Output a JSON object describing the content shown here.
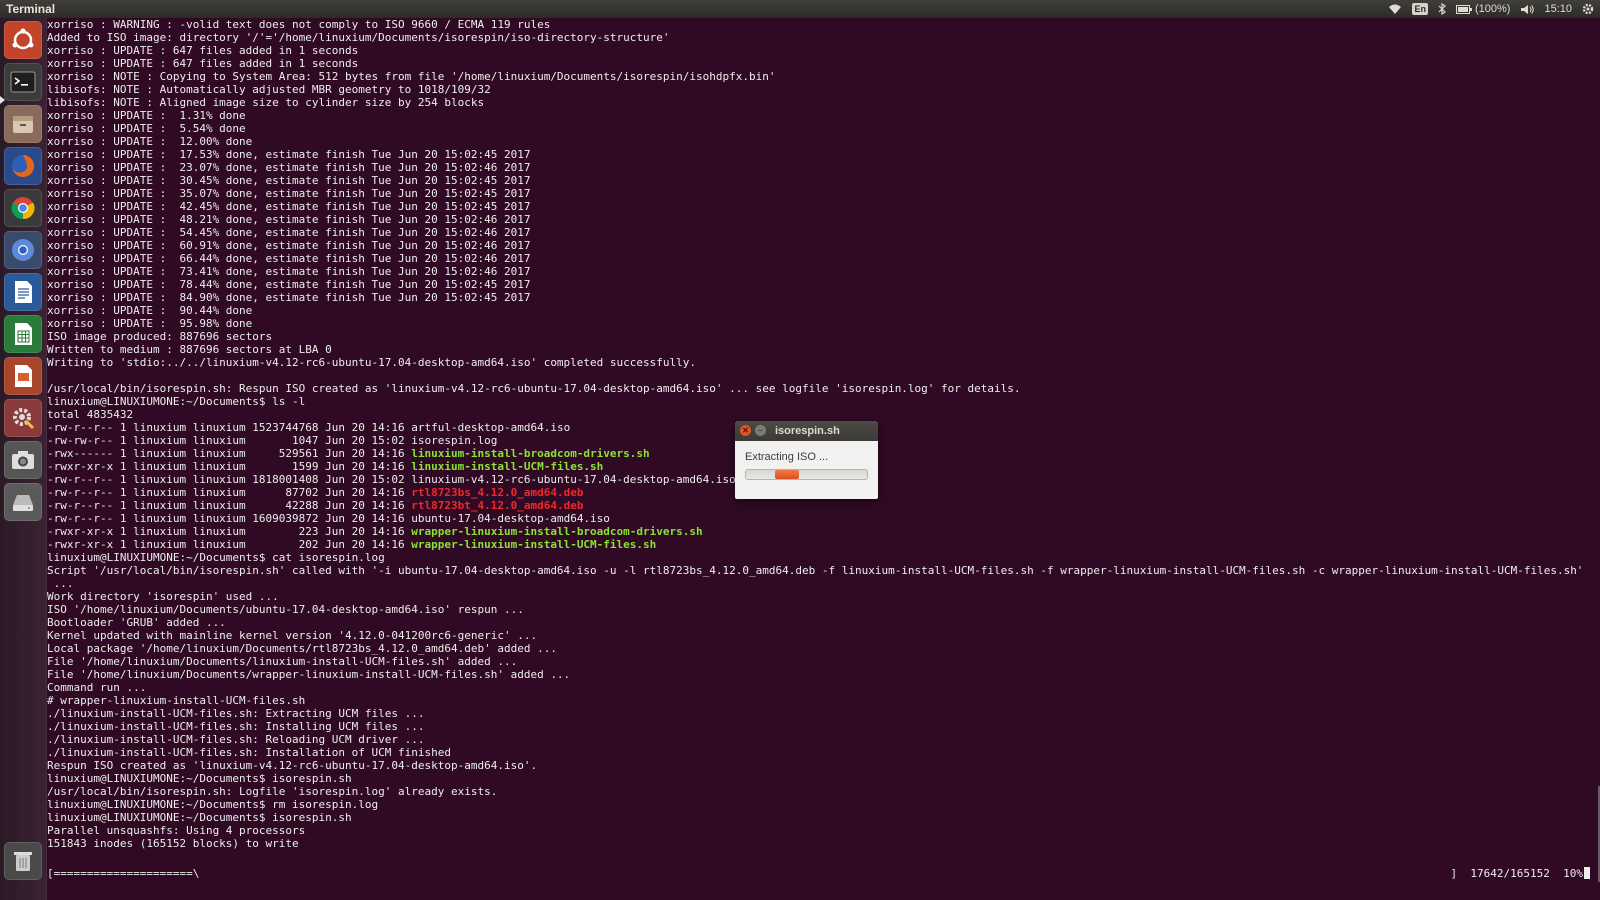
{
  "window": {
    "title": "Terminal"
  },
  "tray": {
    "lang": "En",
    "battery": "(100%)",
    "time": "15:10"
  },
  "launcher": {
    "items": [
      {
        "name": "dash-home"
      },
      {
        "name": "terminal-app"
      },
      {
        "name": "files-app"
      },
      {
        "name": "firefox-app"
      },
      {
        "name": "chrome-app"
      },
      {
        "name": "chromium-app"
      },
      {
        "name": "libreoffice-writer-app"
      },
      {
        "name": "libreoffice-calc-app"
      },
      {
        "name": "libreoffice-impress-app"
      },
      {
        "name": "system-settings-app"
      },
      {
        "name": "screenshot-app"
      },
      {
        "name": "drive-app"
      },
      {
        "name": "trash"
      }
    ]
  },
  "colors": {
    "terminal_bg": "#300a24",
    "exec_green": "#8ae234",
    "pkg_red": "#ef2929"
  },
  "terminal": {
    "lines": [
      {
        "text": "xorriso : WARNING : -volid text does not comply to ISO 9660 / ECMA 119 rules"
      },
      {
        "text": "Added to ISO image: directory '/'='/home/linuxium/Documents/isorespin/iso-directory-structure'"
      },
      {
        "text": "xorriso : UPDATE : 647 files added in 1 seconds"
      },
      {
        "text": "xorriso : UPDATE : 647 files added in 1 seconds"
      },
      {
        "text": "xorriso : NOTE : Copying to System Area: 512 bytes from file '/home/linuxium/Documents/isorespin/isohdpfx.bin'"
      },
      {
        "text": "libisofs: NOTE : Automatically adjusted MBR geometry to 1018/109/32"
      },
      {
        "text": "libisofs: NOTE : Aligned image size to cylinder size by 254 blocks"
      },
      {
        "text": "xorriso : UPDATE :  1.31% done"
      },
      {
        "text": "xorriso : UPDATE :  5.54% done"
      },
      {
        "text": "xorriso : UPDATE :  12.00% done"
      },
      {
        "text": "xorriso : UPDATE :  17.53% done, estimate finish Tue Jun 20 15:02:45 2017"
      },
      {
        "text": "xorriso : UPDATE :  23.07% done, estimate finish Tue Jun 20 15:02:46 2017"
      },
      {
        "text": "xorriso : UPDATE :  30.45% done, estimate finish Tue Jun 20 15:02:45 2017"
      },
      {
        "text": "xorriso : UPDATE :  35.07% done, estimate finish Tue Jun 20 15:02:45 2017"
      },
      {
        "text": "xorriso : UPDATE :  42.45% done, estimate finish Tue Jun 20 15:02:45 2017"
      },
      {
        "text": "xorriso : UPDATE :  48.21% done, estimate finish Tue Jun 20 15:02:46 2017"
      },
      {
        "text": "xorriso : UPDATE :  54.45% done, estimate finish Tue Jun 20 15:02:46 2017"
      },
      {
        "text": "xorriso : UPDATE :  60.91% done, estimate finish Tue Jun 20 15:02:46 2017"
      },
      {
        "text": "xorriso : UPDATE :  66.44% done, estimate finish Tue Jun 20 15:02:46 2017"
      },
      {
        "text": "xorriso : UPDATE :  73.41% done, estimate finish Tue Jun 20 15:02:46 2017"
      },
      {
        "text": "xorriso : UPDATE :  78.44% done, estimate finish Tue Jun 20 15:02:45 2017"
      },
      {
        "text": "xorriso : UPDATE :  84.90% done, estimate finish Tue Jun 20 15:02:45 2017"
      },
      {
        "text": "xorriso : UPDATE :  90.44% done"
      },
      {
        "text": "xorriso : UPDATE :  95.98% done"
      },
      {
        "text": "ISO image produced: 887696 sectors"
      },
      {
        "text": "Written to medium : 887696 sectors at LBA 0"
      },
      {
        "text": "Writing to 'stdio:../../linuxium-v4.12-rc6-ubuntu-17.04-desktop-amd64.iso' completed successfully."
      },
      {
        "text": ""
      },
      {
        "text": "/usr/local/bin/isorespin.sh: Respun ISO created as 'linuxium-v4.12-rc6-ubuntu-17.04-desktop-amd64.iso' ... see logfile 'isorespin.log' for details."
      },
      {
        "text": "linuxium@LINUXIUMONE:~/Documents$ ls -l"
      },
      {
        "text": "total 4835432"
      },
      {
        "text": "-rw-r--r-- 1 linuxium linuxium 1523744768 Jun 20 14:16 ",
        "file": "artful-desktop-amd64.iso",
        "cls": ""
      },
      {
        "text": "-rw-rw-r-- 1 linuxium linuxium       1047 Jun 20 15:02 ",
        "file": "isorespin.log",
        "cls": ""
      },
      {
        "text": "-rwx------ 1 linuxium linuxium     529561 Jun 20 14:16 ",
        "file": "linuxium-install-broadcom-drivers.sh",
        "cls": "green"
      },
      {
        "text": "-rwxr-xr-x 1 linuxium linuxium       1599 Jun 20 14:16 ",
        "file": "linuxium-install-UCM-files.sh",
        "cls": "green"
      },
      {
        "text": "-rw-r--r-- 1 linuxium linuxium 1818001408 Jun 20 15:02 ",
        "file": "linuxium-v4.12-rc6-ubuntu-17.04-desktop-amd64.iso",
        "cls": ""
      },
      {
        "text": "-rw-r--r-- 1 linuxium linuxium      87702 Jun 20 14:16 ",
        "file": "rtl8723bs_4.12.0_amd64.deb",
        "cls": "red"
      },
      {
        "text": "-rw-r--r-- 1 linuxium linuxium      42288 Jun 20 14:16 ",
        "file": "rtl8723bt_4.12.0_amd64.deb",
        "cls": "red"
      },
      {
        "text": "-rw-r--r-- 1 linuxium linuxium 1609039872 Jun 20 14:16 ",
        "file": "ubuntu-17.04-desktop-amd64.iso",
        "cls": ""
      },
      {
        "text": "-rwxr-xr-x 1 linuxium linuxium        223 Jun 20 14:16 ",
        "file": "wrapper-linuxium-install-broadcom-drivers.sh",
        "cls": "green"
      },
      {
        "text": "-rwxr-xr-x 1 linuxium linuxium        202 Jun 20 14:16 ",
        "file": "wrapper-linuxium-install-UCM-files.sh",
        "cls": "green"
      },
      {
        "text": "linuxium@LINUXIUMONE:~/Documents$ cat isorespin.log"
      },
      {
        "text": "Script '/usr/local/bin/isorespin.sh' called with '-i ubuntu-17.04-desktop-amd64.iso -u -l rtl8723bs_4.12.0_amd64.deb -f linuxium-install-UCM-files.sh -f wrapper-linuxium-install-UCM-files.sh -c wrapper-linuxium-install-UCM-files.sh'"
      },
      {
        "text": " ..."
      },
      {
        "text": "Work directory 'isorespin' used ..."
      },
      {
        "text": "ISO '/home/linuxium/Documents/ubuntu-17.04-desktop-amd64.iso' respun ..."
      },
      {
        "text": "Bootloader 'GRUB' added ..."
      },
      {
        "text": "Kernel updated with mainline kernel version '4.12.0-041200rc6-generic' ..."
      },
      {
        "text": "Local package '/home/linuxium/Documents/rtl8723bs_4.12.0_amd64.deb' added ..."
      },
      {
        "text": "File '/home/linuxium/Documents/linuxium-install-UCM-files.sh' added ..."
      },
      {
        "text": "File '/home/linuxium/Documents/wrapper-linuxium-install-UCM-files.sh' added ..."
      },
      {
        "text": "Command run ..."
      },
      {
        "text": "# wrapper-linuxium-install-UCM-files.sh"
      },
      {
        "text": "./linuxium-install-UCM-files.sh: Extracting UCM files ..."
      },
      {
        "text": "./linuxium-install-UCM-files.sh: Installing UCM files ..."
      },
      {
        "text": "./linuxium-install-UCM-files.sh: Reloading UCM driver ..."
      },
      {
        "text": "./linuxium-install-UCM-files.sh: Installation of UCM finished"
      },
      {
        "text": "Respun ISO created as 'linuxium-v4.12-rc6-ubuntu-17.04-desktop-amd64.iso'."
      },
      {
        "text": "linuxium@LINUXIUMONE:~/Documents$ isorespin.sh"
      },
      {
        "text": "/usr/local/bin/isorespin.sh: Logfile 'isorespin.log' already exists."
      },
      {
        "text": "linuxium@LINUXIUMONE:~/Documents$ rm isorespin.log"
      },
      {
        "text": "linuxium@LINUXIUMONE:~/Documents$ isorespin.sh"
      },
      {
        "text": "Parallel unsquashfs: Using 4 processors"
      },
      {
        "text": "151843 inodes (165152 blocks) to write"
      },
      {
        "text": ""
      }
    ],
    "status": {
      "bar": "[=====================\\",
      "bracket": "]",
      "blocks": "17642/165152",
      "percent": "10%"
    }
  },
  "dialog": {
    "title": "isorespin.sh",
    "message": "Extracting ISO ...",
    "progress": 0.2
  }
}
